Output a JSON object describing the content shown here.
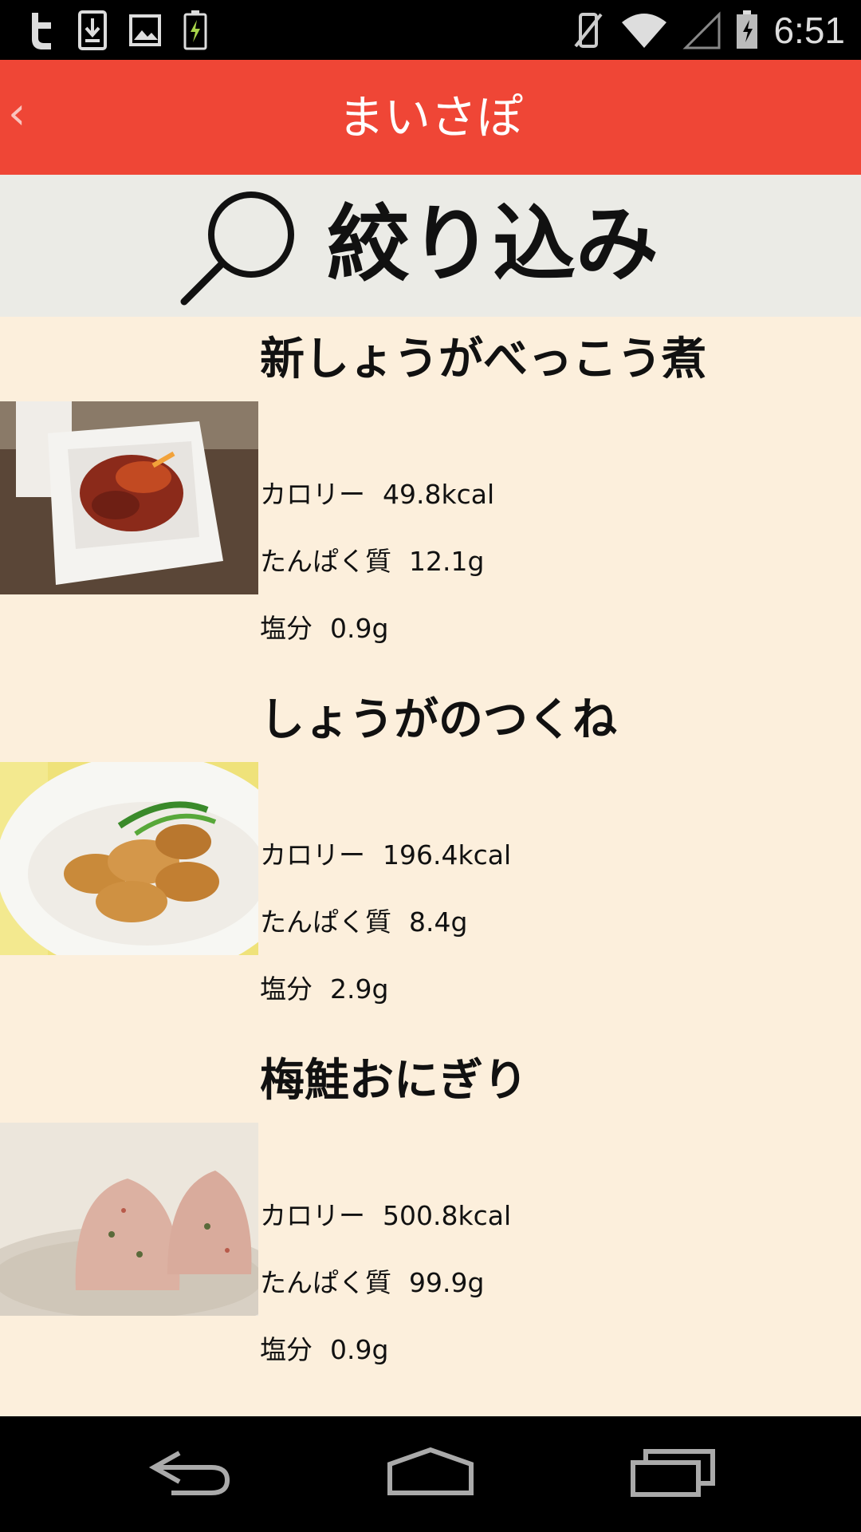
{
  "status_bar": {
    "time": "6:51",
    "left_icons": [
      "twitter-icon",
      "download-icon",
      "gallery-icon",
      "battery-charging-icon"
    ],
    "right_icons": [
      "vibrate-mute-icon",
      "wifi-icon",
      "signal-icon",
      "battery-icon"
    ]
  },
  "app_bar": {
    "back_glyph": "‹",
    "title": "まいさぽ"
  },
  "filter": {
    "label": "絞り込み",
    "icon": "search-icon"
  },
  "recipes": [
    {
      "name": "新しょうがべっこう煮",
      "calorie_label": "カロリー",
      "calorie": "49.8kcal",
      "protein_label": "たんぱく質",
      "protein": "12.1g",
      "salt_label": "塩分",
      "salt": "0.9g"
    },
    {
      "name": "しょうがのつくね",
      "calorie_label": "カロリー",
      "calorie": "196.4kcal",
      "protein_label": "たんぱく質",
      "protein": "8.4g",
      "salt_label": "塩分",
      "salt": "2.9g"
    },
    {
      "name": "梅鮭おにぎり",
      "calorie_label": "カロリー",
      "calorie": "500.8kcal",
      "protein_label": "たんぱく質",
      "protein": "99.9g",
      "salt_label": "塩分",
      "salt": "0.9g"
    }
  ],
  "nav_bar": {
    "buttons": [
      "back-icon",
      "home-icon",
      "recents-icon"
    ]
  },
  "colors": {
    "app_bar": "#ef4636",
    "filter_bar": "#ebebe6",
    "list_bg": "#fcefdc",
    "status_bar": "#000000"
  }
}
